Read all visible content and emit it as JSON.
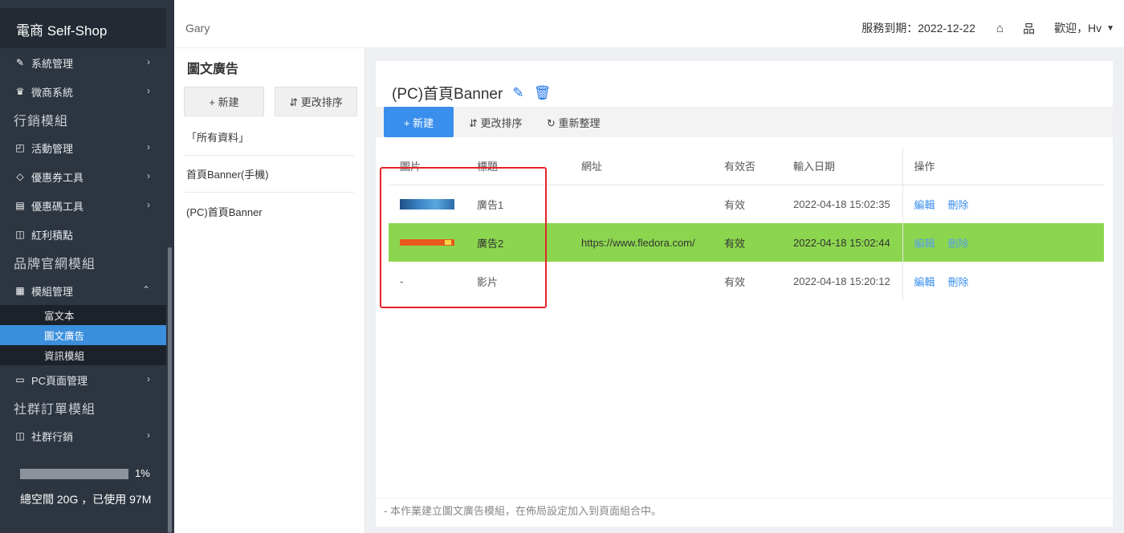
{
  "sidebar": {
    "brand": "電商 Self-Shop",
    "items": [
      {
        "type": "item",
        "icon": "wrench-icon",
        "glyph": "✎",
        "label": "系統管理",
        "chevron": "›"
      },
      {
        "type": "item",
        "icon": "users-icon",
        "glyph": "♛",
        "label": "微商系統",
        "chevron": "›"
      },
      {
        "type": "section",
        "label": "行銷模組"
      },
      {
        "type": "item",
        "icon": "bag-icon",
        "glyph": "◰",
        "label": "活動管理",
        "chevron": "›"
      },
      {
        "type": "item",
        "icon": "tag-icon",
        "glyph": "◇",
        "label": "優惠券工具",
        "chevron": "›"
      },
      {
        "type": "item",
        "icon": "gift-icon",
        "glyph": "▤",
        "label": "優惠碼工具",
        "chevron": "›"
      },
      {
        "type": "item",
        "icon": "wallet-icon",
        "glyph": "◫",
        "label": "紅利積點",
        "chevron": ""
      },
      {
        "type": "section",
        "label": "品牌官網模組"
      },
      {
        "type": "item",
        "icon": "grid-icon",
        "glyph": "▦",
        "label": "模組管理",
        "chevron": "⌃"
      },
      {
        "type": "sub",
        "label": "富文本",
        "active": false
      },
      {
        "type": "sub",
        "label": "圖文廣告",
        "active": true
      },
      {
        "type": "sub",
        "label": "資訊模組",
        "active": false
      },
      {
        "type": "item",
        "icon": "monitor-icon",
        "glyph": "▭",
        "label": "PC頁面管理",
        "chevron": "›"
      },
      {
        "type": "section",
        "label": "社群訂單模組"
      },
      {
        "type": "item",
        "icon": "wallet-icon",
        "glyph": "◫",
        "label": "社群行銷",
        "chevron": "›"
      }
    ],
    "storage": {
      "percent_label": "1%",
      "percent": 0.01,
      "text": "總空間 20G ，已使用 97M"
    }
  },
  "topbar": {
    "user": "Gary",
    "expiry": "服務到期：2022-12-22",
    "welcome": "歡迎，Hv"
  },
  "module_panel": {
    "title": "圖文廣告",
    "new_label": "+ 新建",
    "sort_label": "⇵ 更改排序",
    "items": [
      "「所有資料」",
      "首頁Banner(手機)",
      "(PC)首頁Banner"
    ]
  },
  "main": {
    "title": "(PC)首頁Banner",
    "toolbar": {
      "new": "+ 新建",
      "sort": "⇵ 更改排序",
      "refresh": "↻ 重新整理"
    },
    "columns": [
      "圖片",
      "標題",
      "網址",
      "有效否",
      "輸入日期",
      "操作"
    ],
    "rows": [
      {
        "image": "thumb1",
        "title": "廣告1",
        "url": "",
        "valid": "有效",
        "date": "2022-04-18 15:02:35",
        "edit": "編輯",
        "delete": "刪除",
        "highlight": false
      },
      {
        "image": "thumb2",
        "title": "廣告2",
        "url": "https://www.fledora.com/",
        "valid": "有效",
        "date": "2022-04-18 15:02:44",
        "edit": "編輯",
        "delete": "刪除",
        "highlight": true
      },
      {
        "image": "-",
        "title": "影片",
        "url": "",
        "valid": "有效",
        "date": "2022-04-18 15:20:12",
        "edit": "編輯",
        "delete": "刪除",
        "highlight": false
      }
    ],
    "footnote": "- 本作業建立圖文廣告模組，在佈局設定加入到頁面組合中。"
  },
  "colors": {
    "accent": "#3b8fec",
    "highlight_row": "#8cd64f",
    "sidebar": "#2d3540",
    "annotation": "#e3242b"
  }
}
